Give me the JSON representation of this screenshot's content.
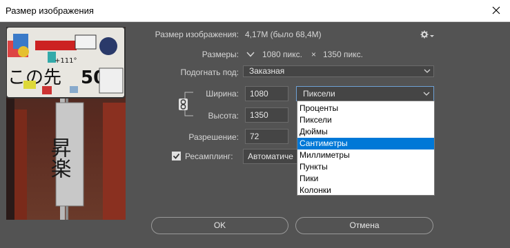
{
  "window": {
    "title": "Размер изображения"
  },
  "image_size": {
    "label": "Размер изображения:",
    "value": "4,17M (было 68,4M)"
  },
  "dimensions": {
    "label": "Размеры:",
    "width": "1080 пикс.",
    "times": "×",
    "height": "1350 пикс."
  },
  "fit_to": {
    "label": "Подогнать под:",
    "value": "Заказная"
  },
  "width": {
    "label": "Ширина:",
    "value": "1080"
  },
  "height": {
    "label": "Высота:",
    "value": "1350"
  },
  "resolution": {
    "label": "Разрешение:",
    "value": "72"
  },
  "resample": {
    "label": "Ресамплинг:",
    "value": "Автоматиче"
  },
  "units": {
    "selected": "Пиксели",
    "options": [
      "Проценты",
      "Пиксели",
      "Дюймы",
      "Сантиметры",
      "Миллиметры",
      "Пункты",
      "Пики",
      "Колонки"
    ],
    "highlighted": "Сантиметры"
  },
  "buttons": {
    "ok": "OK",
    "cancel": "Отмена"
  },
  "preview_text": {
    "sign_top": "+111°",
    "sign_main": "この先",
    "sign_num": "50",
    "vertical": "昇楽"
  },
  "colors": {
    "background": "#535353",
    "highlight": "#0078d7",
    "focus_border": "#6ea2d6"
  }
}
